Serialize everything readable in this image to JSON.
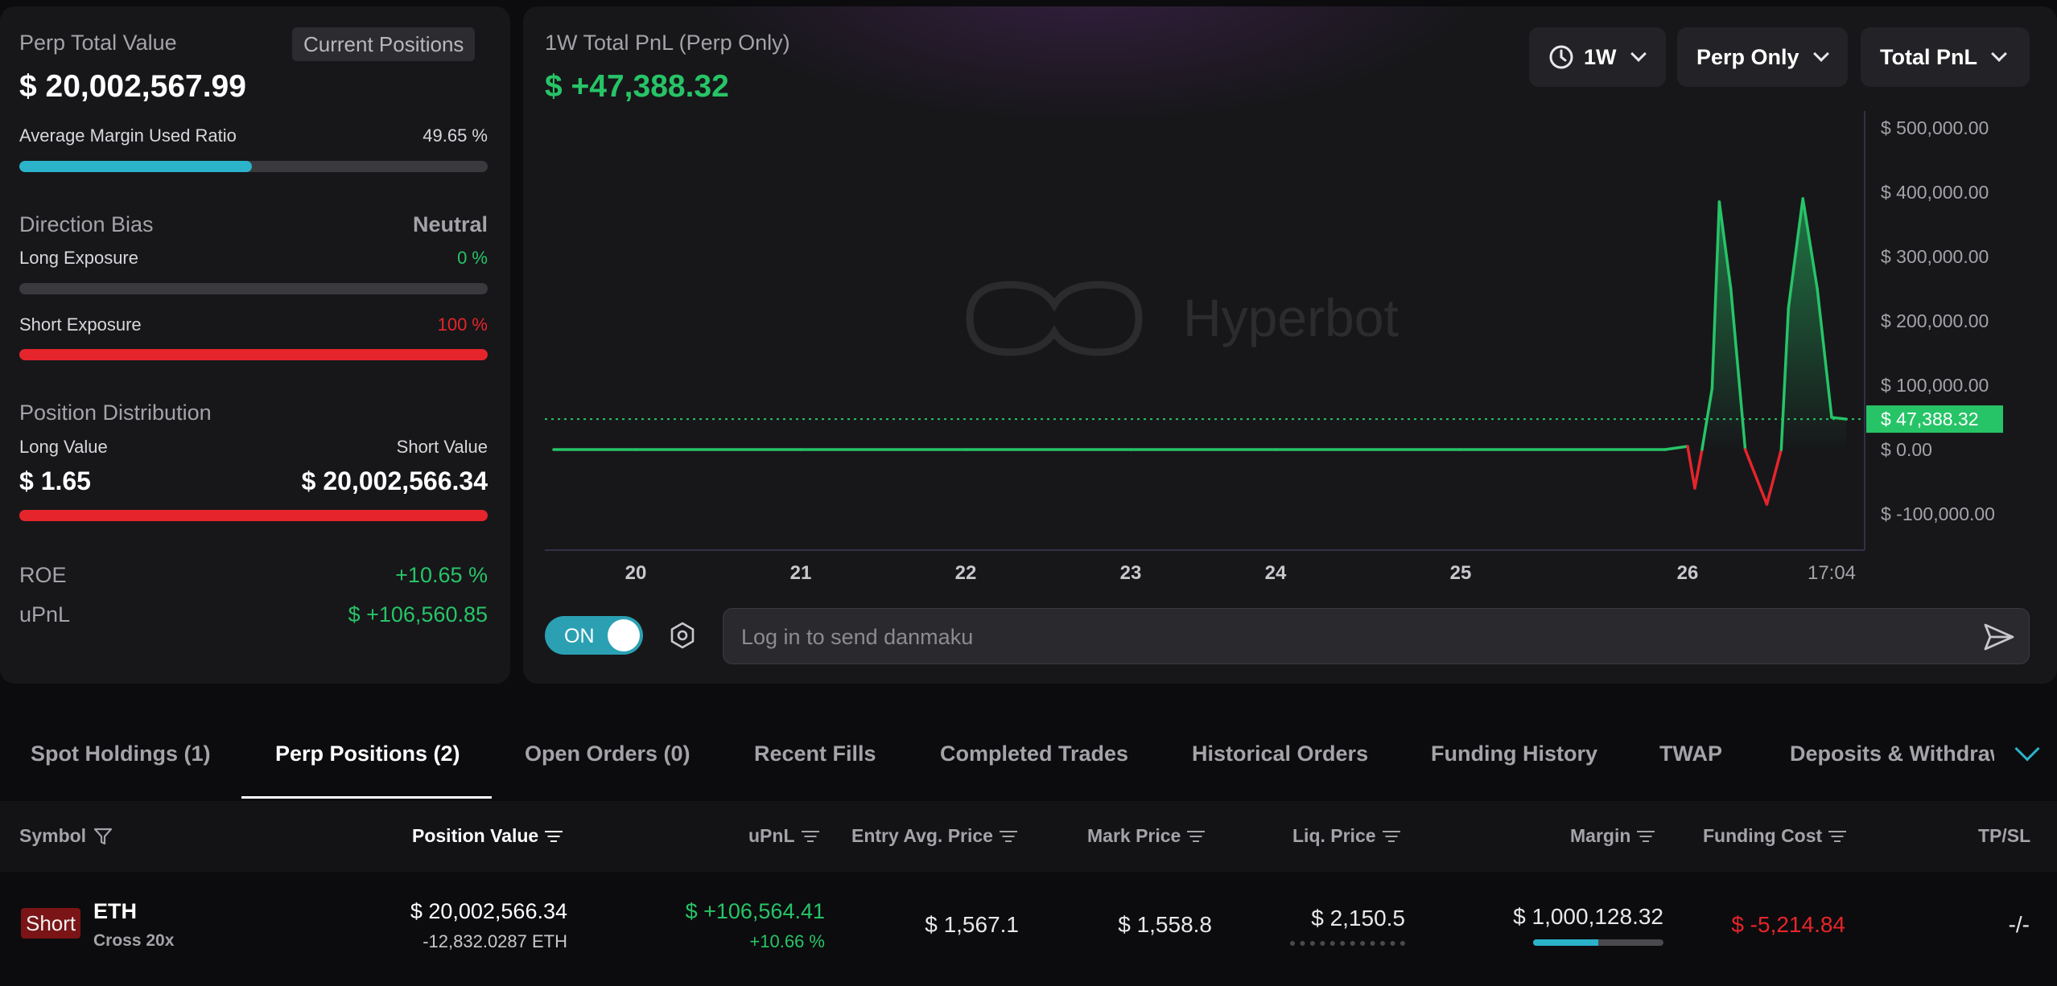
{
  "summary": {
    "perp_total_value_label": "Perp Total Value",
    "current_positions_button": "Current Positions",
    "perp_total_value": "$ 20,002,567.99",
    "avg_margin_label": "Average Margin Used Ratio",
    "avg_margin_value": "49.65 %",
    "avg_margin_ratio": 0.4965,
    "direction_bias_label": "Direction Bias",
    "direction_bias_value": "Neutral",
    "long_exposure_label": "Long Exposure",
    "long_exposure_value": "0 %",
    "long_exposure_ratio": 0,
    "short_exposure_label": "Short Exposure",
    "short_exposure_value": "100 %",
    "short_exposure_ratio": 1.0,
    "position_distribution_label": "Position Distribution",
    "long_value_label": "Long Value",
    "short_value_label": "Short Value",
    "long_value": "$ 1.65",
    "short_value": "$ 20,002,566.34",
    "roe_label": "ROE",
    "roe_value": "+10.65 %",
    "upnl_label": "uPnL",
    "upnl_value": "$ +106,560.85"
  },
  "chart_panel": {
    "title": "1W Total PnL (Perp Only)",
    "total_pnl": "$ +47,388.32",
    "period_dropdown": "1W",
    "scope_dropdown": "Perp Only",
    "metric_dropdown": "Total PnL",
    "watermark": "Hyperbot",
    "current_label": "$ 47,388.32",
    "danmaku_toggle": "ON",
    "danmaku_placeholder": "Log in to send danmaku"
  },
  "chart_data": {
    "type": "line",
    "title": "1W Total PnL (Perp Only)",
    "xlabel": "",
    "ylabel": "",
    "x_tick_labels": [
      "20",
      "21",
      "22",
      "23",
      "24",
      "25",
      "26",
      "17:04"
    ],
    "y_tick_labels": [
      "$ 500,000.00",
      "$ 400,000.00",
      "$ 300,000.00",
      "$ 200,000.00",
      "$ 100,000.00",
      "$ 0.00",
      "$ -100,000.00"
    ],
    "ylim": [
      -155000,
      520000
    ],
    "current_value": 47388.32,
    "grid": false,
    "series": [
      {
        "x": [
          19.5,
          20,
          21,
          22,
          23,
          24,
          25,
          25.9,
          26.0,
          26.05,
          26.1,
          26.17,
          26.22,
          26.3,
          26.4,
          26.55,
          26.65,
          26.7,
          26.8,
          26.9,
          27.0,
          27.1
        ],
        "y": [
          0,
          0,
          0,
          0,
          0,
          0,
          0,
          0,
          5000,
          -60000,
          0,
          95000,
          385000,
          250000,
          0,
          -85000,
          0,
          220000,
          390000,
          250000,
          50000,
          47388.32
        ]
      }
    ]
  },
  "tabs": [
    "Spot Holdings (1)",
    "Perp Positions (2)",
    "Open Orders (0)",
    "Recent Fills",
    "Completed Trades",
    "Historical Orders",
    "Funding History",
    "TWAP",
    "Deposits & Withdraw"
  ],
  "active_tab": "Perp Positions (2)",
  "table": {
    "headers": {
      "symbol": "Symbol",
      "position_value": "Position Value",
      "upnl": "uPnL",
      "entry_avg_price": "Entry Avg. Price",
      "mark_price": "Mark Price",
      "liq_price": "Liq. Price",
      "margin": "Margin",
      "funding_cost": "Funding Cost",
      "tpsl": "TP/SL"
    },
    "rows": [
      {
        "side": "Short",
        "symbol": "ETH",
        "mode": "Cross 20x",
        "position_value": "$ 20,002,566.34",
        "position_size": "-12,832.0287 ETH",
        "upnl": "$ +106,564.41",
        "upnl_pct": "+10.66 %",
        "entry_avg_price": "$ 1,567.1",
        "mark_price": "$ 1,558.8",
        "liq_price": "$ 2,150.5",
        "margin": "$ 1,000,128.32",
        "margin_ratio": 0.5,
        "funding_cost": "$ -5,214.84",
        "tpsl": "-/-"
      }
    ]
  },
  "colors": {
    "green": "#27c467",
    "red": "#e5252b",
    "teal": "#2bb3c9",
    "bg": "#0c0c0e",
    "panel": "#17171a"
  }
}
